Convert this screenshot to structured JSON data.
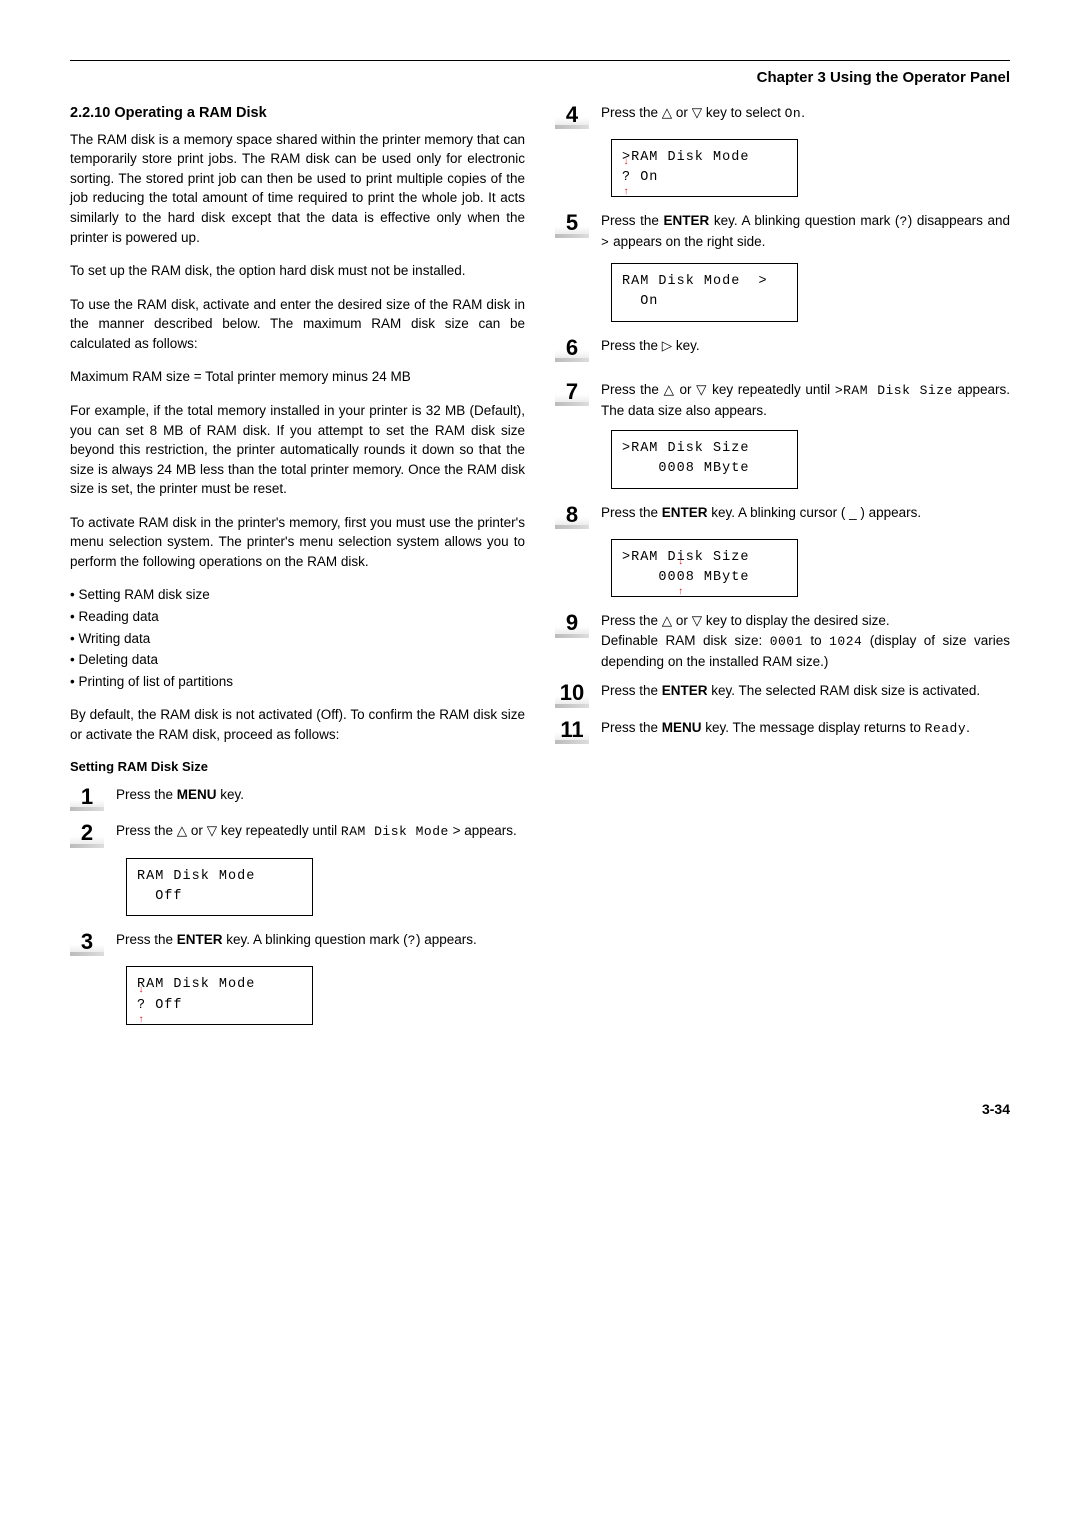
{
  "header": {
    "chapter": "Chapter 3  Using the Operator Panel"
  },
  "left": {
    "section_num": "2.2.10",
    "section_title": "Operating a RAM Disk",
    "p1": "The RAM disk is a memory space shared within the printer memory that can temporarily store print jobs. The RAM disk can be used only for electronic sorting. The stored print job can then be used to print multiple copies of the job reducing the total amount of time required to print the whole job. It acts similarly to the hard disk except that the data is effective only when the printer is powered up.",
    "p2": "To set up the RAM disk, the option hard disk must not be installed.",
    "p3": "To use the RAM disk, activate and enter the desired size of the RAM disk in the manner described below. The maximum RAM disk size can be calculated as follows:",
    "p4": "Maximum RAM size = Total printer memory minus 24 MB",
    "p5": "For example, if the total memory installed in your printer is 32 MB (Default), you can set 8 MB of RAM disk. If you attempt to set the RAM disk size beyond this restriction, the printer automatically rounds it down so that the size is always 24 MB less than the total printer memory. Once the RAM disk size is set, the printer must be reset.",
    "p6": "To activate RAM disk in the printer's memory, first you must use the printer's menu selection system. The printer's menu selection system allows you to perform the following operations on the RAM disk.",
    "bullets": [
      "Setting RAM disk size",
      "Reading data",
      "Writing data",
      "Deleting data",
      "Printing of list of partitions"
    ],
    "p7": "By default, the RAM disk is not activated (Off). To confirm the RAM disk size or activate the RAM disk, proceed as follows:",
    "sub": "Setting RAM Disk Size",
    "step1_pre": "Press the ",
    "step1_b": "MENU",
    "step1_post": " key.",
    "step2_a": "Press the ",
    "step2_b": " or ",
    "step2_c": " key repeatedly until ",
    "step2_mono": "RAM Disk Mode",
    "step2_d": " > appears.",
    "lcd2_l1": "RAM Disk Mode",
    "lcd2_l2": "  Off",
    "step3_a": "Press the ",
    "step3_b": "ENTER",
    "step3_c": " key. A blinking question mark (",
    "step3_mono": "?",
    "step3_d": ") appears.",
    "lcd3_l1": "RAM Disk Mode",
    "lcd3_q": "?",
    "lcd3_l2": " Off"
  },
  "right": {
    "step4_a": "Press the ",
    "step4_b": " or ",
    "step4_c": " key to select ",
    "step4_mono": "On",
    "step4_d": ".",
    "lcd4_l1": ">RAM Disk Mode",
    "lcd4_q": "?",
    "lcd4_l2": " On",
    "step5_a": "Press the ",
    "step5_b": "ENTER",
    "step5_c": " key. A blinking question mark (",
    "step5_mono": "?",
    "step5_d": ") disappears and ",
    "step5_gt": ">",
    "step5_e": "  appears on the right side.",
    "lcd5_l1": "RAM Disk Mode  >",
    "lcd5_l2": "  On",
    "step6_a": "Press the ",
    "step6_b": " key.",
    "step7_a": "Press the ",
    "step7_b": " or ",
    "step7_c": " key repeatedly until ",
    "step7_mono": ">RAM Disk Size",
    "step7_d": " appears. The data size also appears.",
    "lcd7_l1": ">RAM Disk Size",
    "lcd7_l2": "    0008 MByte",
    "step8_a": "Press the ",
    "step8_b": "ENTER",
    "step8_c": " key. A blinking cursor ( _ ) appears.",
    "lcd8_l1": ">RAM Disk Size",
    "lcd8_pre": "    00",
    "lcd8_blink": "0",
    "lcd8_post": "8 MByte",
    "step9_a": "Press the ",
    "step9_b": " or ",
    "step9_c": " key to display the desired size.",
    "step9_l2a": "Definable RAM disk size: ",
    "step9_m1": "0001",
    "step9_l2b": " to ",
    "step9_m2": "1024",
    "step9_l2c": " (display of size varies depending on the installed RAM size.)",
    "step10_a": "Press the ",
    "step10_b": "ENTER",
    "step10_c": " key. The selected RAM disk size is activated.",
    "step11_a": "Press the ",
    "step11_b": "MENU",
    "step11_c": " key. The message display returns to ",
    "step11_mono": "Ready",
    "step11_d": "."
  },
  "footer": {
    "page": "3-34"
  },
  "glyph": {
    "up": "△",
    "down": "▽",
    "right": "▷"
  }
}
